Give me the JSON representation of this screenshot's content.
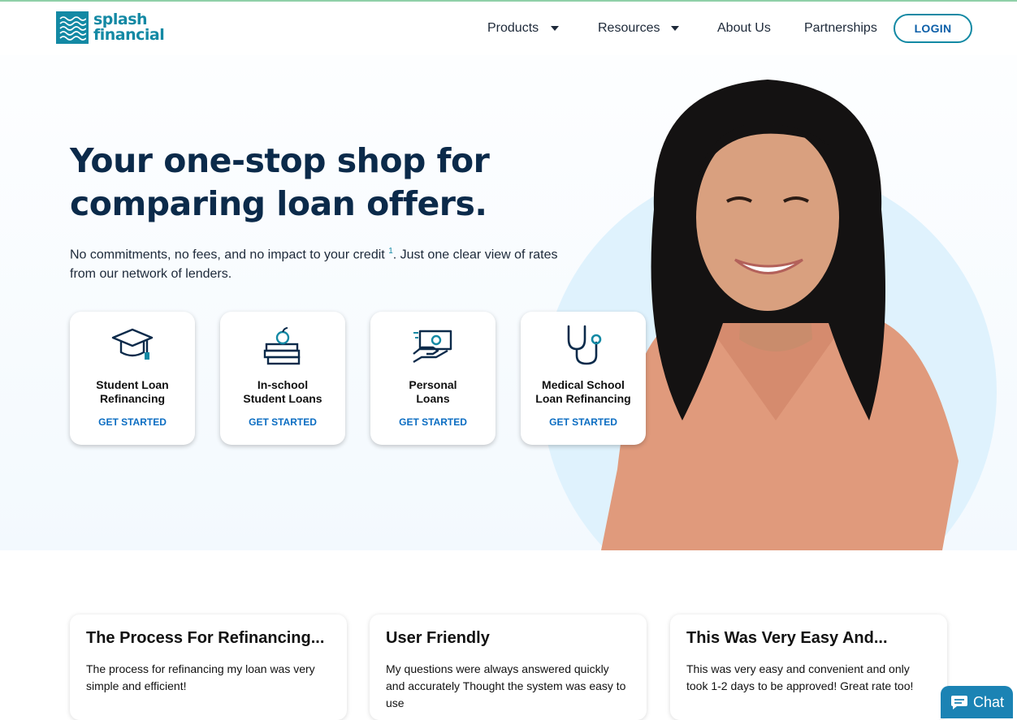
{
  "brand": {
    "line1": "splash",
    "line2": "financial"
  },
  "nav": {
    "products": "Products",
    "resources": "Resources",
    "about": "About Us",
    "partnerships": "Partnerships",
    "login": "LOGIN"
  },
  "hero": {
    "headline": "Your one-stop shop for comparing loan offers.",
    "sub_before": "No commitments, no fees, and no impact to your credit",
    "sub_sup": "1",
    "sub_after": ". Just one clear view of rates from our network of lenders."
  },
  "cards": [
    {
      "title": "Student Loan\nRefinancing",
      "cta": "GET STARTED",
      "icon": "graduation-cap-icon"
    },
    {
      "title": "In-school\nStudent Loans",
      "cta": "GET STARTED",
      "icon": "books-apple-icon"
    },
    {
      "title": "Personal\nLoans",
      "cta": "GET STARTED",
      "icon": "hand-money-icon"
    },
    {
      "title": "Medical School\nLoan Refinancing",
      "cta": "GET STARTED",
      "icon": "stethoscope-icon"
    }
  ],
  "reviews": [
    {
      "title": "The Process For Refinancing...",
      "body": "The process for refinancing my loan was very simple and efficient!"
    },
    {
      "title": "User Friendly",
      "body": "My questions were always answered quickly and accurately Thought the system was easy to use"
    },
    {
      "title": "This Was Very Easy And...",
      "body": "This was very easy and convenient and only took 1-2 days to be approved! Great rate too!"
    }
  ],
  "chat": {
    "label": "Chat"
  },
  "colors": {
    "brand": "#1389a4",
    "navy": "#0b2a4a",
    "link": "#0b6dc2"
  }
}
